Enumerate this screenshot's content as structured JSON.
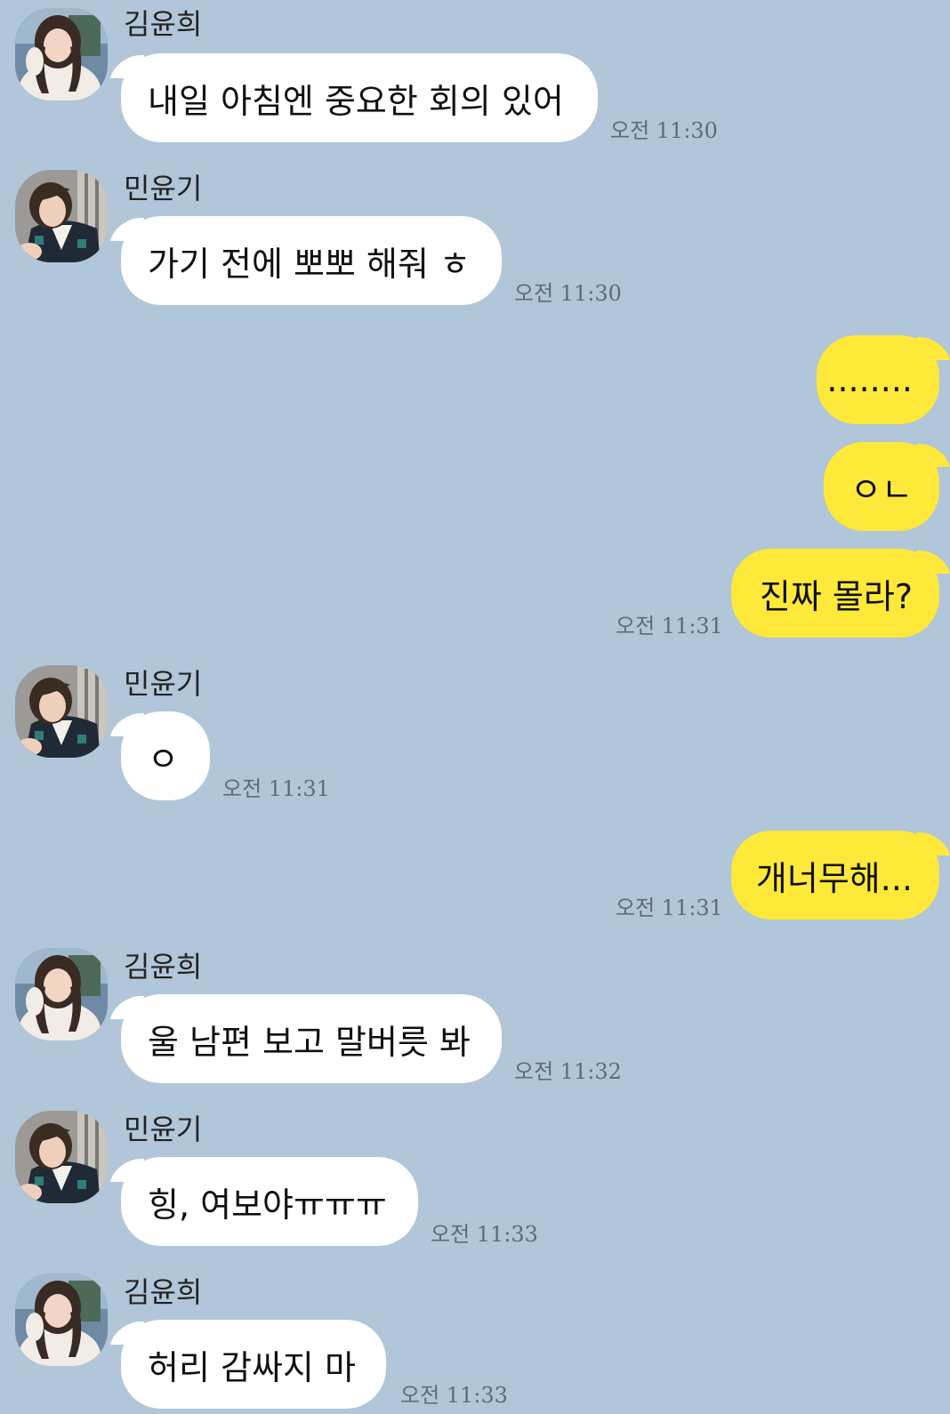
{
  "chat": {
    "time_prefix": "오전",
    "participants": {
      "yunhui": {
        "name": "김윤희",
        "avatar_icon": "profile-photo-girl-white-sweater-icon"
      },
      "yungi": {
        "name": "민윤기",
        "avatar_icon": "profile-photo-boy-dark-vest-icon"
      }
    },
    "colors": {
      "background": "#b1c6d9",
      "incoming_bubble": "#ffffff",
      "outgoing_bubble": "#fee93a",
      "timestamp": "#5f6b76"
    },
    "messages": [
      {
        "direction": "in",
        "sender": "김윤희",
        "text": "내일 아침엔 중요한 회의 있어",
        "time": "오전 11:30"
      },
      {
        "direction": "in",
        "sender": "민윤기",
        "text": "가기 전에 뽀뽀 해줘 ㅎ",
        "time": "오전 11:30"
      },
      {
        "direction": "out",
        "text": "........",
        "time": ""
      },
      {
        "direction": "out",
        "text": "ㅇㄴ",
        "time": ""
      },
      {
        "direction": "out",
        "text": "진짜 몰라?",
        "time": "오전 11:31"
      },
      {
        "direction": "in",
        "sender": "민윤기",
        "text": "ㅇ",
        "time": "오전 11:31"
      },
      {
        "direction": "out",
        "text": "개너무해...",
        "time": "오전 11:31"
      },
      {
        "direction": "in",
        "sender": "김윤희",
        "text": "울 남편 보고 말버릇 봐",
        "time": "오전 11:32"
      },
      {
        "direction": "in",
        "sender": "민윤기",
        "text": "힝, 여보야ㅠㅠㅠ",
        "time": "오전 11:33"
      },
      {
        "direction": "in",
        "sender": "김윤희",
        "text": "허리 감싸지 마",
        "time": "오전 11:33"
      }
    ]
  }
}
